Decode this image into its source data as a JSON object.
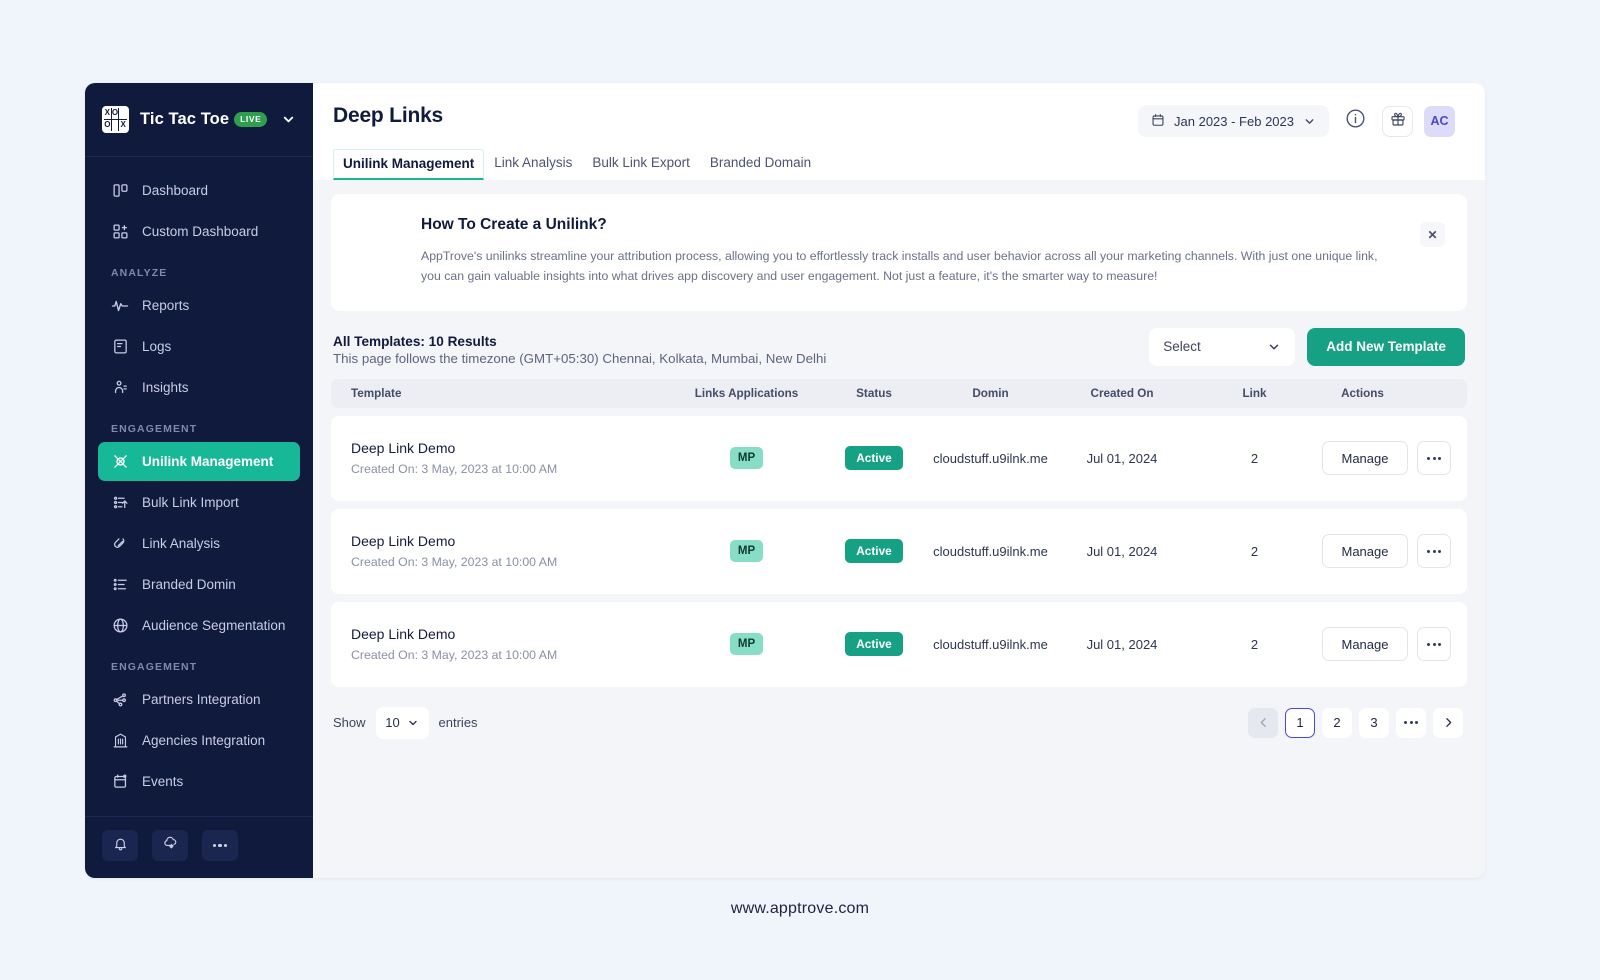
{
  "brand": {
    "name": "Tic Tac Toe",
    "badge": "LIVE",
    "logo_cells": [
      "X",
      "O",
      "",
      "O",
      "",
      "X"
    ]
  },
  "sidebar": {
    "items": [
      {
        "label": "Dashboard",
        "icon": "dashboard-icon",
        "type": "item",
        "active": false
      },
      {
        "label": "Custom Dashboard",
        "icon": "custom-dashboard-icon",
        "type": "item",
        "active": false
      },
      {
        "label": "ANALYZE",
        "type": "section"
      },
      {
        "label": "Reports",
        "icon": "reports-icon",
        "type": "item",
        "active": false
      },
      {
        "label": "Logs",
        "icon": "logs-icon",
        "type": "item",
        "active": false
      },
      {
        "label": "Insights",
        "icon": "insights-icon",
        "type": "item",
        "active": false
      },
      {
        "label": "ENGAGEMENT",
        "type": "section"
      },
      {
        "label": "Unilink Management",
        "icon": "unilink-icon",
        "type": "item",
        "active": true
      },
      {
        "label": "Bulk Link Import",
        "icon": "bulk-import-icon",
        "type": "item",
        "active": false
      },
      {
        "label": "Link Analysis",
        "icon": "link-analysis-icon",
        "type": "item",
        "active": false
      },
      {
        "label": "Branded Domin",
        "icon": "branded-domain-icon",
        "type": "item",
        "active": false
      },
      {
        "label": "Audience Segmentation",
        "icon": "globe-icon",
        "type": "item",
        "active": false
      },
      {
        "label": "ENGAGEMENT",
        "type": "section"
      },
      {
        "label": "Partners Integration",
        "icon": "partners-icon",
        "type": "item",
        "active": false
      },
      {
        "label": "Agencies Integration",
        "icon": "agencies-icon",
        "type": "item",
        "active": false
      },
      {
        "label": "Events",
        "icon": "events-icon",
        "type": "item",
        "active": false
      }
    ],
    "footer_buttons": [
      {
        "icon": "bell-icon",
        "name": "notifications-button"
      },
      {
        "icon": "cloud-download-icon",
        "name": "downloads-button"
      },
      {
        "icon": "more-icon",
        "name": "more-button"
      }
    ]
  },
  "header": {
    "title": "Deep Links",
    "date_range": "Jan 2023 - Feb 2023",
    "avatar_initials": "AC",
    "tabs": [
      {
        "label": "Unilink Management",
        "active": true
      },
      {
        "label": "Link Analysis",
        "active": false
      },
      {
        "label": "Bulk Link Export",
        "active": false
      },
      {
        "label": "Branded Domain",
        "active": false
      }
    ]
  },
  "banner": {
    "title": "How To Create a Unilink?",
    "body": "AppTrove's unilinks streamline your attribution process, allowing you to effortlessly track installs and user behavior across all your marketing channels. With just one unique link, you can gain valuable insights into what drives app discovery and user engagement. Not just a feature, it's the smarter way to measure!",
    "close_label": "✕"
  },
  "results": {
    "title": "All Templates: 10 Results",
    "subtitle": "This page follows the timezone (GMT+05:30) Chennai, Kolkata, Mumbai, New Delhi",
    "select_value": "Select",
    "add_button": "Add New Template"
  },
  "table": {
    "columns": [
      "Template",
      "Links Applications",
      "Status",
      "Domin",
      "Created On",
      "Link",
      "Actions"
    ],
    "rows": [
      {
        "template": "Deep Link Demo",
        "created_sub": "Created On: 3 May, 2023 at 10:00 AM",
        "apps": "MP",
        "status": "Active",
        "domain": "cloudstuff.u9ilnk.me",
        "created_on": "Jul 01, 2024",
        "link": "2",
        "manage": "Manage"
      },
      {
        "template": "Deep Link Demo",
        "created_sub": "Created On: 3 May, 2023 at 10:00 AM",
        "apps": "MP",
        "status": "Active",
        "domain": "cloudstuff.u9ilnk.me",
        "created_on": "Jul 01, 2024",
        "link": "2",
        "manage": "Manage"
      },
      {
        "template": "Deep Link Demo",
        "created_sub": "Created On: 3 May, 2023 at 10:00 AM",
        "apps": "MP",
        "status": "Active",
        "domain": "cloudstuff.u9ilnk.me",
        "created_on": "Jul 01, 2024",
        "link": "2",
        "manage": "Manage"
      }
    ]
  },
  "pagination": {
    "show_label": "Show",
    "entries_label": "entries",
    "page_size": "10",
    "pages": [
      "1",
      "2",
      "3",
      "•••"
    ],
    "current_page": "1"
  },
  "footer": {
    "url": "www.apptrove.com"
  },
  "colors": {
    "sidebar_bg": "#101a3d",
    "accent_green": "#17a184",
    "active_nav": "#17b897",
    "chip_mp": "#87ddc6",
    "avatar_bg": "#dcdcf8",
    "page_bg": "#f0f4fb"
  }
}
